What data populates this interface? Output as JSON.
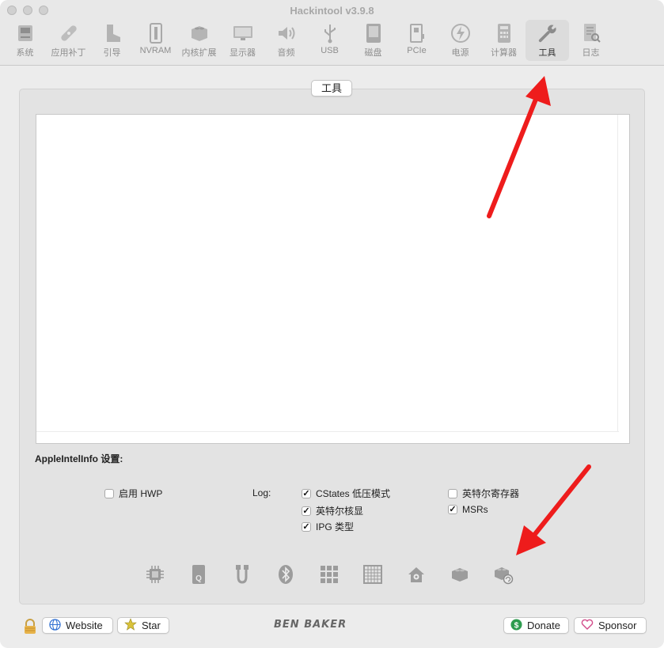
{
  "window": {
    "title": "Hackintool v3.9.8"
  },
  "toolbar": {
    "items": [
      {
        "label": "系统",
        "icon": "computer-icon"
      },
      {
        "label": "应用补丁",
        "icon": "bandage-icon"
      },
      {
        "label": "引导",
        "icon": "boot-icon"
      },
      {
        "label": "NVRAM",
        "icon": "nvram-icon"
      },
      {
        "label": "内核扩展",
        "icon": "lego-icon"
      },
      {
        "label": "显示器",
        "icon": "monitor-icon"
      },
      {
        "label": "音频",
        "icon": "speaker-icon"
      },
      {
        "label": "USB",
        "icon": "usb-icon"
      },
      {
        "label": "磁盘",
        "icon": "disk-icon"
      },
      {
        "label": "PCIe",
        "icon": "pcie-icon"
      },
      {
        "label": "电源",
        "icon": "power-icon"
      },
      {
        "label": "计算器",
        "icon": "calculator-icon"
      },
      {
        "label": "工具",
        "icon": "wrench-icon"
      },
      {
        "label": "日志",
        "icon": "log-icon"
      }
    ],
    "active": "工具"
  },
  "panel": {
    "tab_label": "工具"
  },
  "settings": {
    "title": "AppleIntelInfo 设置:",
    "hwp": {
      "label": "启用 HWP",
      "checked": false
    },
    "log_label": "Log:",
    "options": [
      {
        "label": "CStates 低压模式",
        "checked": true
      },
      {
        "label": "英特尔寄存器",
        "checked": false
      },
      {
        "label": "英特尔核显",
        "checked": true
      },
      {
        "label": "MSRs",
        "checked": true
      },
      {
        "label": "IPG 类型",
        "checked": true
      }
    ]
  },
  "bottom_icons": [
    "cpu-icon",
    "disk-q-icon",
    "usb-cable-icon",
    "bluetooth-icon",
    "grid-icon",
    "chip-grid-icon",
    "home-gear-icon",
    "lego-icon",
    "lego-refresh-icon"
  ],
  "footer": {
    "website": "Website",
    "star": "Star",
    "brand": "BEN BAKER",
    "donate": "Donate",
    "sponsor": "Sponsor"
  },
  "check_mark": "✓"
}
